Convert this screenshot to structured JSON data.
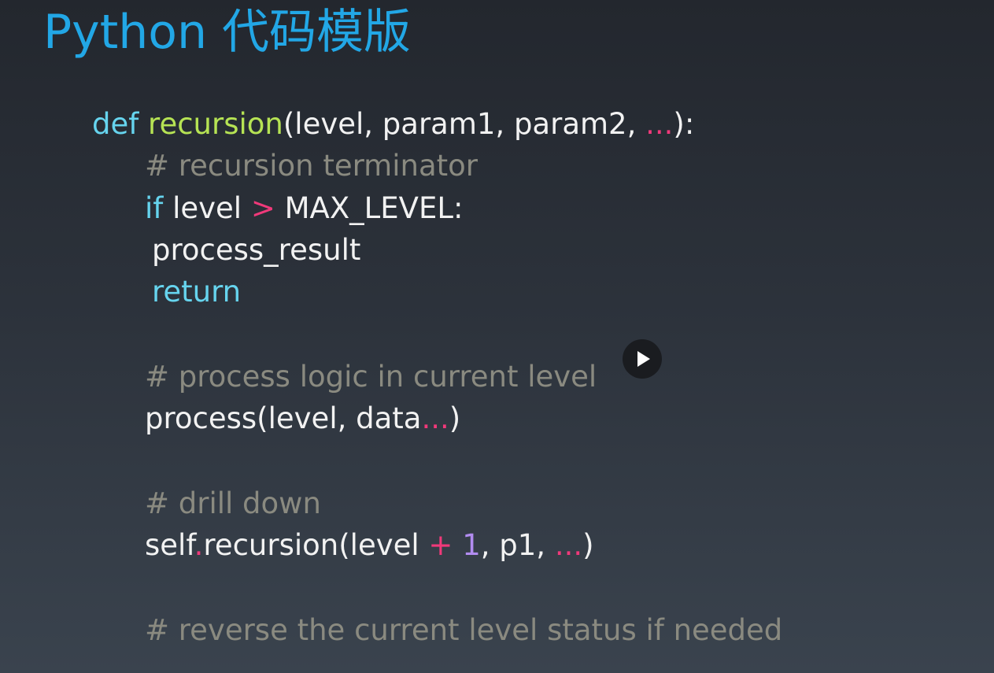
{
  "slide": {
    "title": "Python 代码模版"
  },
  "code": {
    "line1": {
      "kw_def": "def",
      "sp": " ",
      "fn_name": "recursion",
      "params_open": "(level, param1, param2, ",
      "ellipsis": "...",
      "params_close": "):"
    },
    "line2": {
      "comment": "# recursion terminator"
    },
    "line3": {
      "kw_if": "if",
      "part1": " level ",
      "op_gt": ">",
      "part2": " MAX_LEVEL:"
    },
    "line4": {
      "text": "process_result"
    },
    "line5": {
      "kw_return": "return"
    },
    "line6": {
      "comment": "# process logic in current level"
    },
    "line7": {
      "part1": "process(level, data",
      "ellipsis": "...",
      "part2": ")"
    },
    "line8": {
      "comment": "# drill down"
    },
    "line9": {
      "part1": "self",
      "dot": ".",
      "part2": "recursion(level ",
      "op_plus": "+",
      "sp": " ",
      "num_one": "1",
      "part3": ", p1, ",
      "ellipsis": "...",
      "part4": ")"
    },
    "line10": {
      "comment": "# reverse the current level status if needed"
    }
  },
  "colors": {
    "title": "#22a7e6",
    "keyword": "#66d4ee",
    "function": "#b6e354",
    "operator": "#f0397a",
    "number": "#b28cf0",
    "comment": "#8a8a80",
    "plain": "#f2f2f2"
  },
  "video": {
    "play_icon": "play-icon"
  }
}
